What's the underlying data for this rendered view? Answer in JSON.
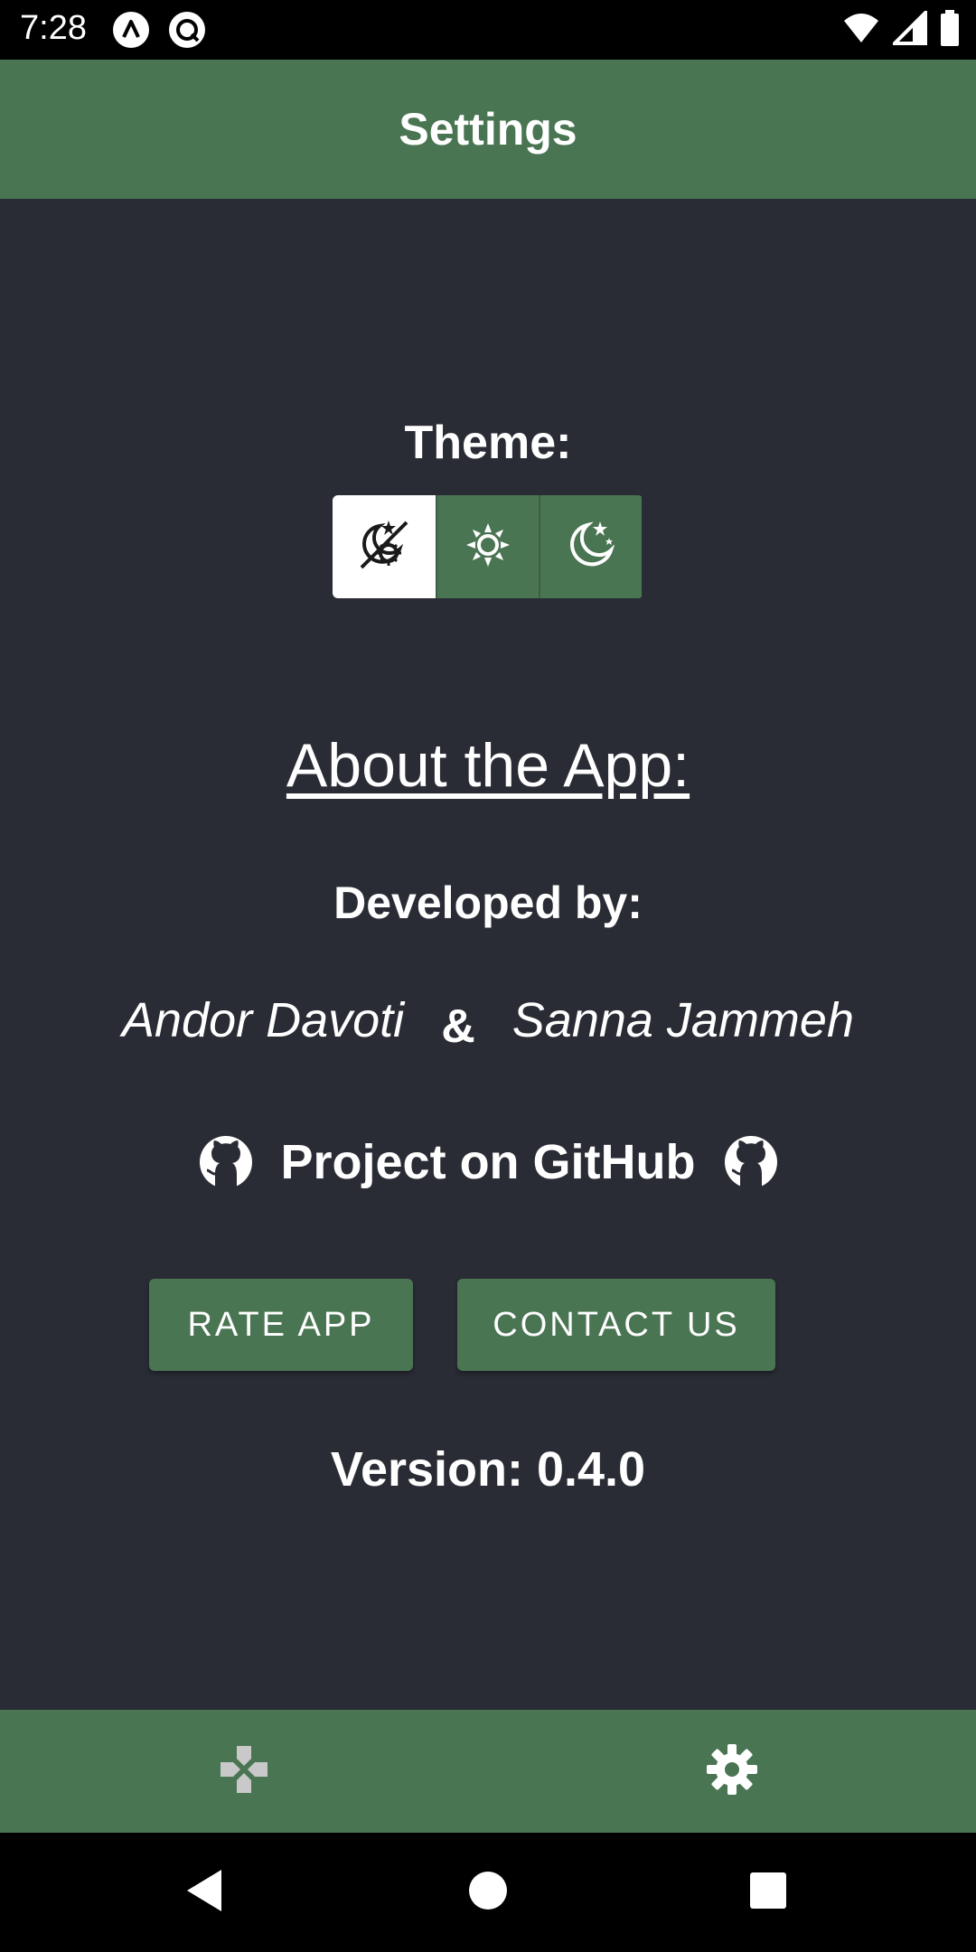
{
  "status_bar": {
    "time": "7:28",
    "icons": [
      "app-a-icon",
      "app-r-icon",
      "wifi-icon",
      "signal-icon",
      "battery-icon"
    ]
  },
  "app_bar": {
    "title": "Settings"
  },
  "theme": {
    "label": "Theme:",
    "options": [
      {
        "icon": "auto-theme-icon",
        "selected": true
      },
      {
        "icon": "sun-icon",
        "selected": false
      },
      {
        "icon": "moon-icon",
        "selected": false
      }
    ]
  },
  "about": {
    "title": "About the App:",
    "developed_by": "Developed by:",
    "developer_1": "Andor Davoti",
    "separator": "&",
    "developer_2": "Sanna Jammeh",
    "github_label": "Project on GitHub"
  },
  "buttons": {
    "rate": "RATE APP",
    "contact": "CONTACT US"
  },
  "version_text": "Version: 0.4.0",
  "bottom_nav": {
    "items": [
      {
        "icon": "gamepad-icon",
        "active": false
      },
      {
        "icon": "gear-icon",
        "active": true
      }
    ]
  },
  "colors": {
    "background": "#2a2c35",
    "accent": "#4a7553",
    "text": "#ffffff",
    "inactive_icon": "#c9c9c9"
  }
}
